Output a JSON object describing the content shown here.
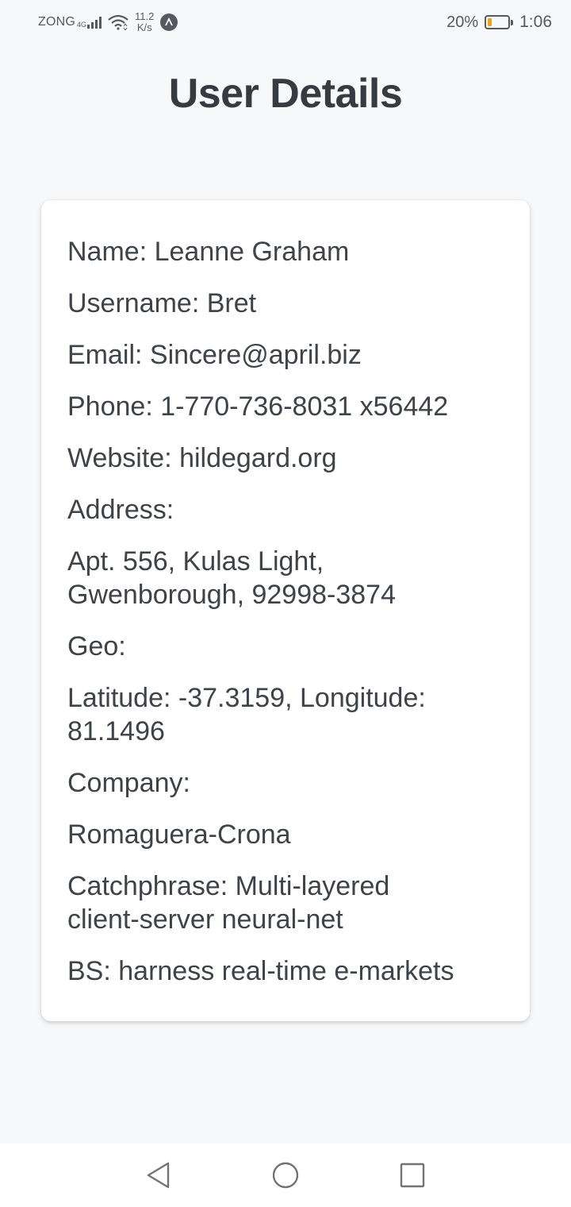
{
  "status_bar": {
    "carrier": "ZONG",
    "network_type": "4G",
    "speed_value": "11.2",
    "speed_unit": "K/s",
    "battery_percent": "20%",
    "battery_level": 0.2,
    "time": "1:06"
  },
  "page": {
    "title": "User Details"
  },
  "user": {
    "name_line": "Name: Leanne Graham",
    "username_line": "Username: Bret",
    "email_line": "Email: Sincere@april.biz",
    "phone_line": "Phone: 1-770-736-8031 x56442",
    "website_line": "Website: hildegard.org",
    "address_label": "Address:",
    "address_value": "Apt. 556, Kulas Light,\nGwenborough, 92998-3874",
    "geo_label": "Geo:",
    "geo_value": "Latitude: -37.3159, Longitude:\n81.1496",
    "company_label": "Company:",
    "company_name": "Romaguera-Crona",
    "catchphrase_line": "Catchphrase: Multi-layered\nclient-server neural-net",
    "bs_line": "BS: harness real-time e-markets"
  },
  "colors": {
    "background": "#f7f8fa",
    "text": "#363b42",
    "card": "#ffffff",
    "battery_accent": "#f0a020"
  },
  "icons": [
    "signal-icon",
    "wifi-icon",
    "app-notification-icon",
    "battery-icon",
    "back-icon",
    "home-icon",
    "recents-icon"
  ]
}
